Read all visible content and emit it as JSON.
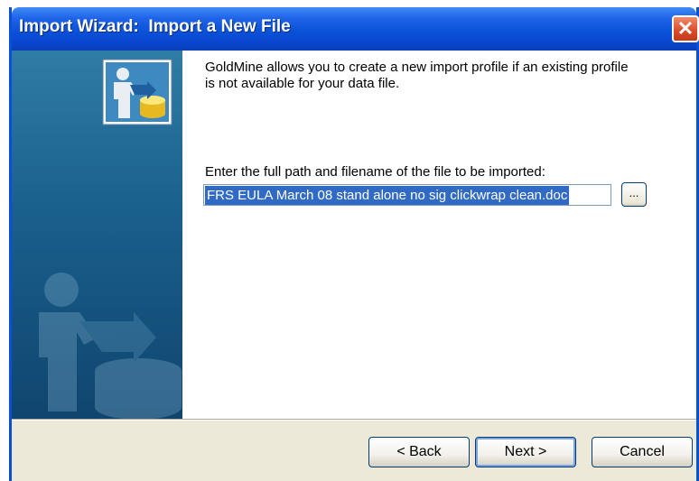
{
  "window": {
    "title": "Import Wizard:  Import a New File",
    "close_glyph": "✕"
  },
  "content": {
    "intro_text": "GoldMine allows you to create a new import profile if an existing profile is not available for your data file.",
    "path_label": "Enter the full path and filename of the file to be imported:",
    "path_value": "FRS EULA March 08 stand alone no sig clickwrap clean.doc",
    "browse_label": "..."
  },
  "buttons": {
    "back": "< Back",
    "next": "Next >",
    "cancel": "Cancel"
  },
  "colors": {
    "titlebar": "#0a52d8",
    "sidepanel": "#1a5f8c",
    "selection": "#316ac5",
    "footer": "#ece9d8"
  },
  "icons": {
    "wizard_icon": "user-database-import-icon",
    "watermark": "user-database-watermark"
  }
}
